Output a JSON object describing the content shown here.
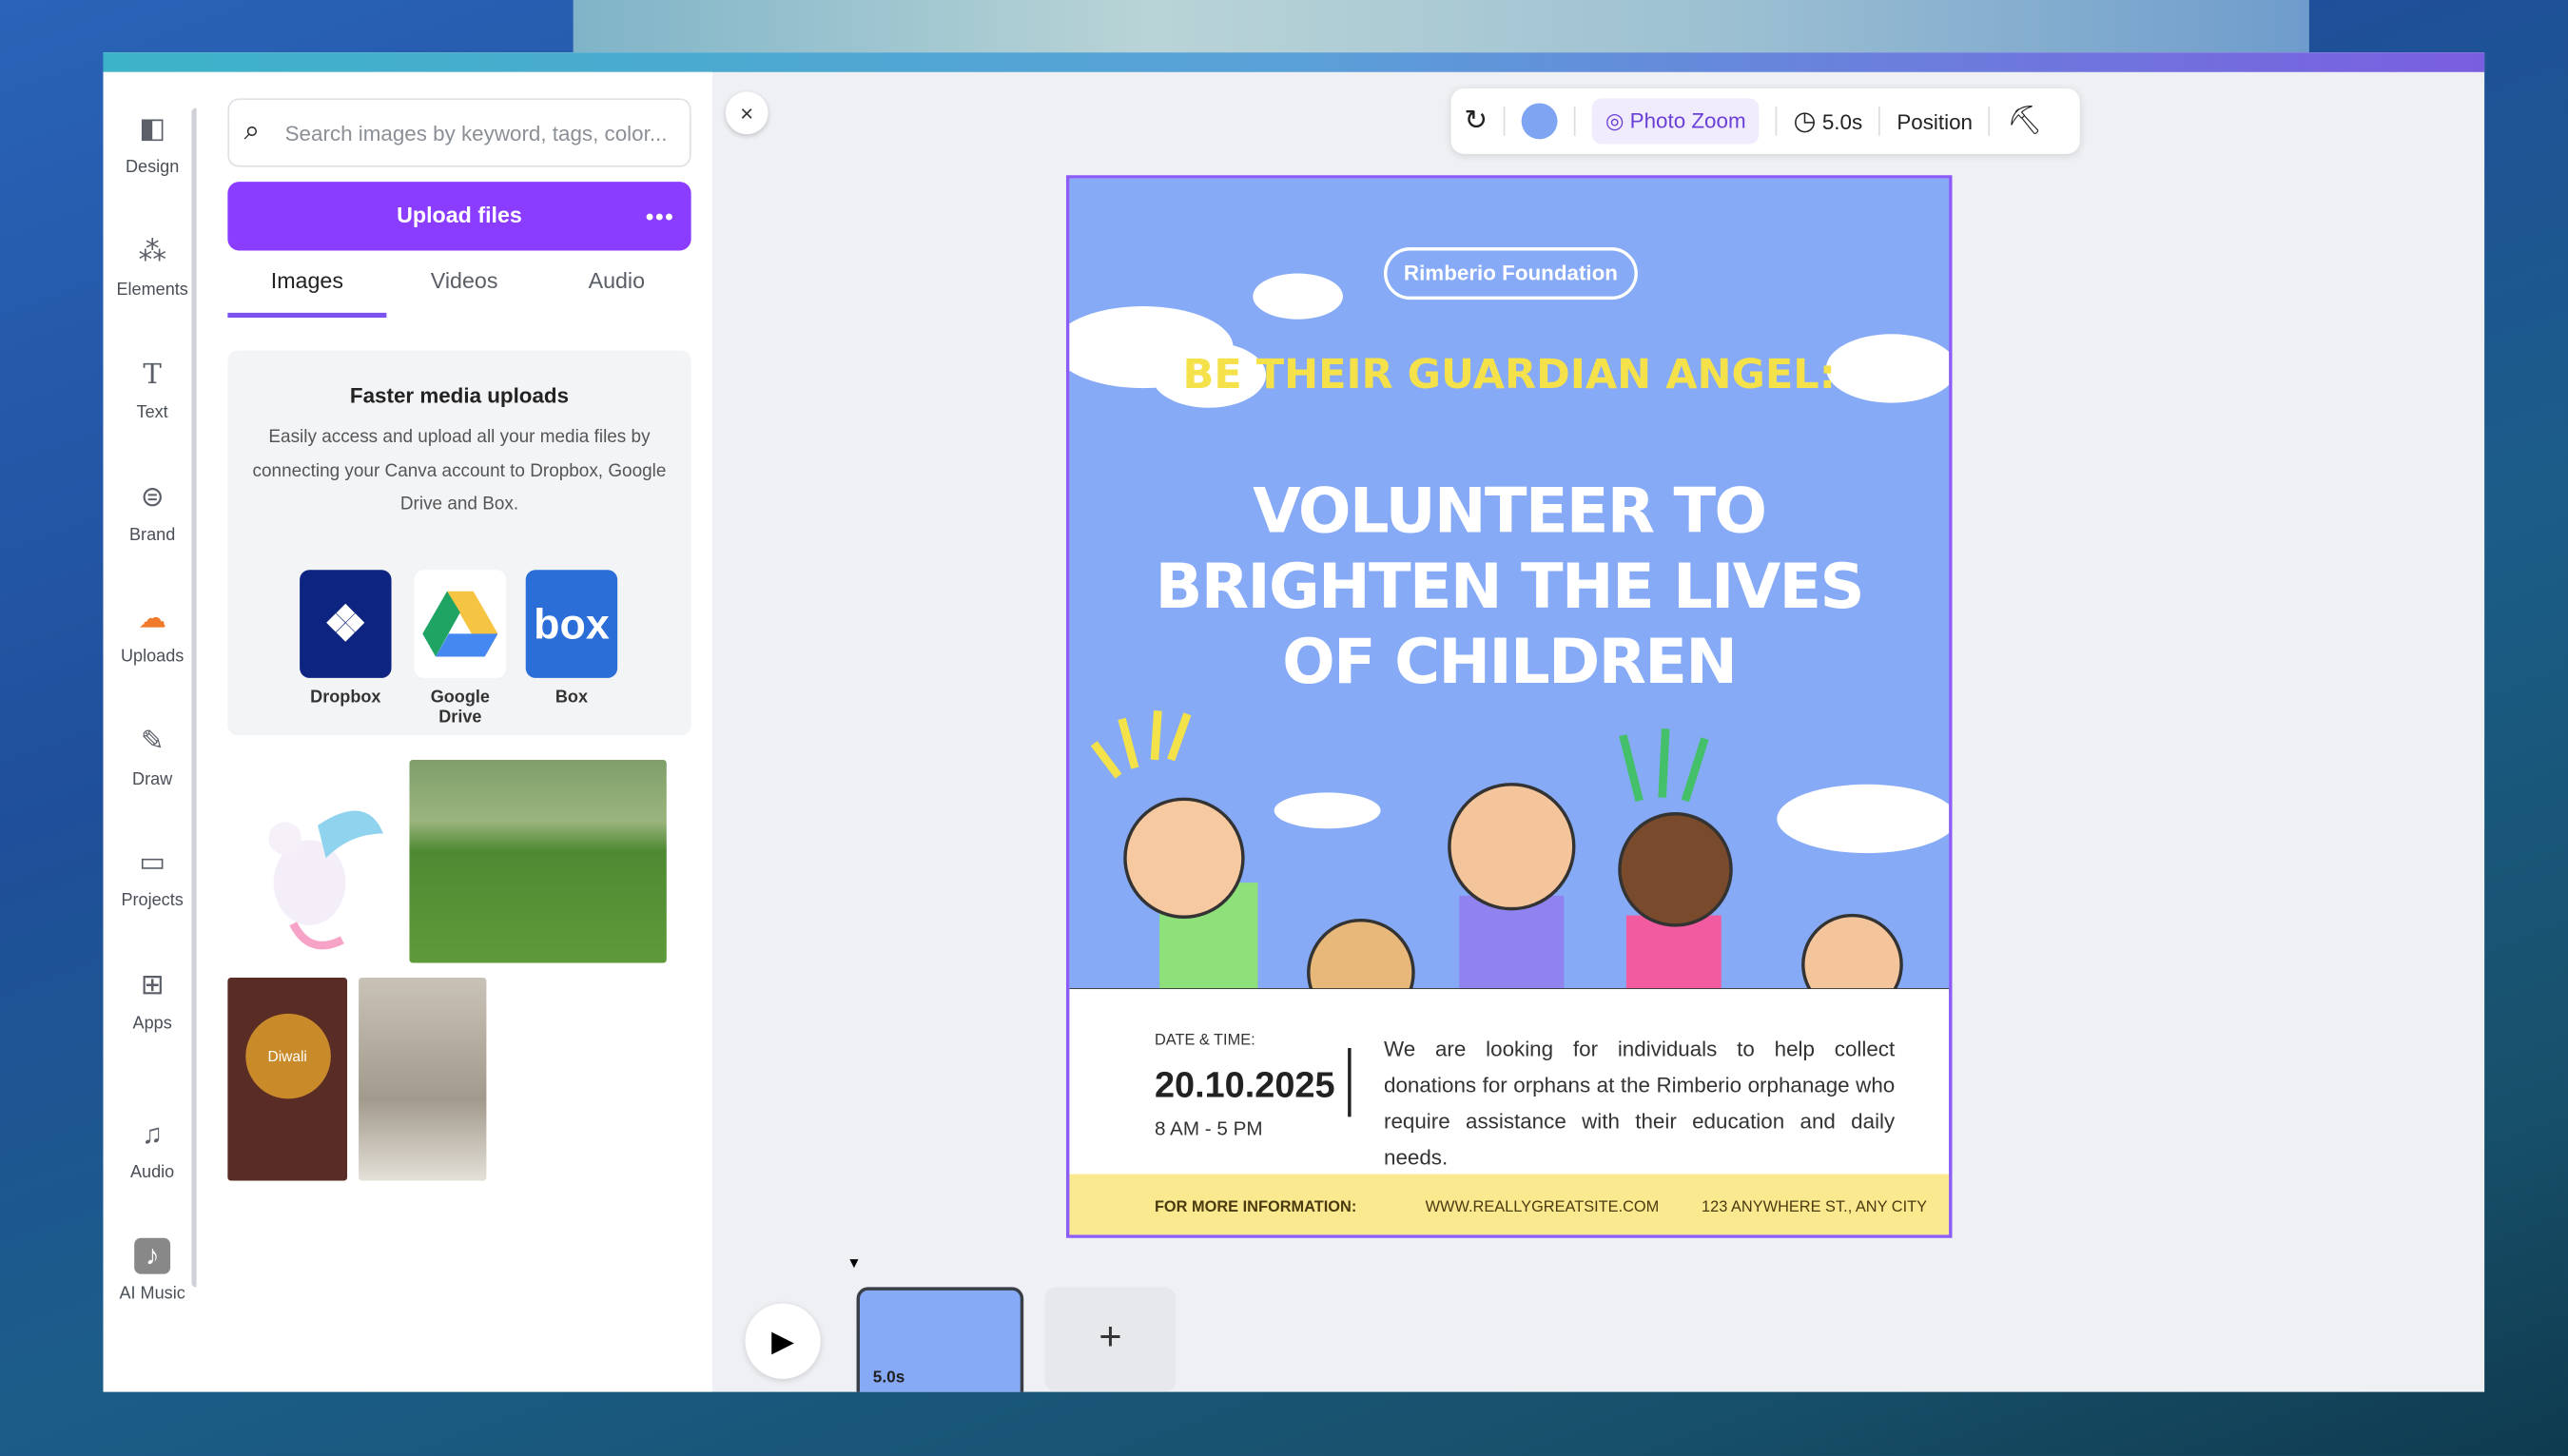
{
  "sidebar": {
    "items": [
      {
        "label": "Design",
        "icon": "design-icon"
      },
      {
        "label": "Elements",
        "icon": "elements-icon"
      },
      {
        "label": "Text",
        "icon": "text-icon"
      },
      {
        "label": "Brand",
        "icon": "brand-icon"
      },
      {
        "label": "Uploads",
        "icon": "upload-cloud-icon",
        "active": true
      },
      {
        "label": "Draw",
        "icon": "draw-icon"
      },
      {
        "label": "Projects",
        "icon": "folder-icon"
      },
      {
        "label": "Apps",
        "icon": "apps-icon"
      },
      {
        "label": "Audio",
        "icon": "music-note-icon"
      },
      {
        "label": "AI Music",
        "icon": "ai-music-icon"
      }
    ]
  },
  "panel": {
    "search_placeholder": "Search images by keyword, tags, color...",
    "upload_label": "Upload files",
    "more_label": "•••",
    "tabs": [
      {
        "label": "Images",
        "active": true
      },
      {
        "label": "Videos"
      },
      {
        "label": "Audio"
      }
    ],
    "card": {
      "title": "Faster media uploads",
      "body": "Easily access and upload all your media files by connecting your Canva account to Dropbox, Google Drive and Box.",
      "services": [
        {
          "label": "Dropbox",
          "color": "#0d2481"
        },
        {
          "label": "Google Drive"
        },
        {
          "label": "Box",
          "color": "#2b6ed8"
        }
      ]
    },
    "thumb_diwali_text": "Diwali"
  },
  "close_label": "×",
  "toolbar": {
    "photo_zoom": "Photo Zoom",
    "duration": "5.0s",
    "position": "Position",
    "color": "#7ea4f2"
  },
  "poster": {
    "org": "Rimberio Foundation",
    "tagline": "BE THEIR GUARDIAN ANGEL:",
    "headline_lines": [
      "VOLUNTEER TO",
      "BRIGHTEN THE LIVES",
      "OF CHILDREN"
    ],
    "date_label": "DATE & TIME:",
    "date": "20.10.2025",
    "time": "8 AM - 5 PM",
    "description": "We are looking for individuals to help collect donations for orphans at the Rimberio orphanage who require assistance with their education and daily needs.",
    "footer": {
      "label": "FOR MORE INFORMATION:",
      "website": "WWW.REALLYGREATSITE.COM",
      "address": "123 ANYWHERE ST., ANY CITY"
    }
  },
  "timeline": {
    "page_duration": "5.0s",
    "add_label": "+",
    "play_label": "▶"
  },
  "colors": {
    "accent": "#8b3dff",
    "sky": "#86aaf6",
    "footer": "#fbe98f"
  }
}
